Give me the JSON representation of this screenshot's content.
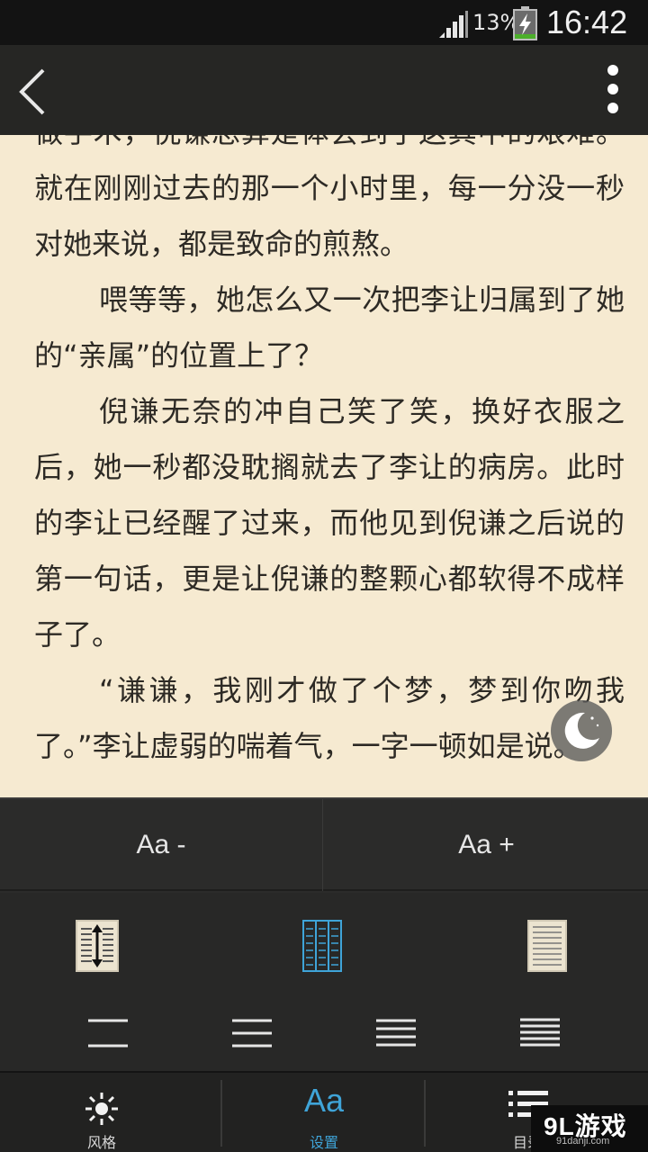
{
  "status_bar": {
    "battery_percent": "13%",
    "battery_level": 0.13,
    "time": "16:42"
  },
  "top_bar": {
    "back_icon": "chevron-left-icon",
    "menu_icon": "more-vertical-icon"
  },
  "reading": {
    "paragraphs": [
      {
        "indent": false,
        "text": "做手术，倪谦总算是体会到了这其中的艰难。就在刚刚过去的那一个小时里，每一分没一秒对她来说，都是致命的煎熬。"
      },
      {
        "indent": true,
        "text": "喂等等，她怎么又一次把李让归属到了她的“亲属”的位置上了？"
      },
      {
        "indent": true,
        "text": "倪谦无奈的冲自己笑了笑，换好衣服之后，她一秒都没耽搁就去了李让的病房。此时的李让已经醒了过来，而他见到倪谦之后说的第一句话，更是让倪谦的整颗心都软得不成样子了。"
      },
      {
        "indent": true,
        "text": "“谦谦，我刚才做了个梦，梦到你吻我了。”李让虚弱的喘着气，一字一顿如是说。"
      }
    ],
    "night_mode_icon": "moon-icon"
  },
  "settings": {
    "font_decrease_label": "Aa -",
    "font_increase_label": "Aa +",
    "page_modes": [
      "scroll-vertical-icon",
      "columns-icon",
      "page-lines-icon"
    ],
    "line_spacing_options": [
      "line-spacing-2-icon",
      "line-spacing-3-icon",
      "line-spacing-4-icon",
      "line-spacing-5-icon"
    ],
    "active_page_mode": "columns-icon",
    "accent_color": "#3fa4d8"
  },
  "bottom_nav": {
    "items": [
      {
        "label": "风格",
        "icon": "sun-icon",
        "active": false
      },
      {
        "label": "设置",
        "icon": "font-aa-icon",
        "active": true
      },
      {
        "label": "目录",
        "icon": "list-icon",
        "active": false
      }
    ]
  },
  "watermark": {
    "logo": "9L游戏",
    "url": "91danji.com"
  }
}
